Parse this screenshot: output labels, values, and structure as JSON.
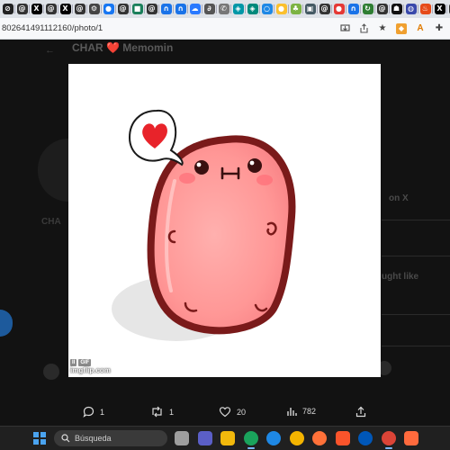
{
  "browser": {
    "tabs": [
      {
        "icon": "x-logo-icon",
        "color": "#222222",
        "glyph": "⊘"
      },
      {
        "icon": "threads-icon",
        "color": "#333333",
        "glyph": "@"
      },
      {
        "icon": "x-logo-icon",
        "color": "#000000",
        "glyph": "X"
      },
      {
        "icon": "threads-icon",
        "color": "#333333",
        "glyph": "@"
      },
      {
        "icon": "x-logo-icon",
        "color": "#000000",
        "glyph": "X"
      },
      {
        "icon": "threads-icon",
        "color": "#333333",
        "glyph": "@"
      },
      {
        "icon": "settings-icon",
        "color": "#444444",
        "glyph": "⚙"
      },
      {
        "icon": "blue-circle-icon",
        "color": "#1877f2",
        "glyph": "●"
      },
      {
        "icon": "threads-icon",
        "color": "#333333",
        "glyph": "@"
      },
      {
        "icon": "green-square-icon",
        "color": "#1a7f5a",
        "glyph": "■"
      },
      {
        "icon": "threads-icon",
        "color": "#333333",
        "glyph": "@"
      },
      {
        "icon": "gmail-icon",
        "color": "#1a73e8",
        "glyph": "∩"
      },
      {
        "icon": "gmail-icon",
        "color": "#1a73e8",
        "glyph": "∩"
      },
      {
        "icon": "cloud-icon",
        "color": "#2979ff",
        "glyph": "☁"
      },
      {
        "icon": "loop-icon",
        "color": "#555555",
        "glyph": "∂"
      },
      {
        "icon": "key-icon",
        "color": "#777777",
        "glyph": "✆"
      },
      {
        "icon": "shield-icon",
        "color": "#0097a7",
        "glyph": "◈"
      },
      {
        "icon": "shield-icon",
        "color": "#00897b",
        "glyph": "◈"
      },
      {
        "icon": "circle-icon",
        "color": "#1e88e5",
        "glyph": "○"
      },
      {
        "icon": "ball-icon",
        "color": "#fbc02d",
        "glyph": "●"
      },
      {
        "icon": "leaf-icon",
        "color": "#7cb342",
        "glyph": "♣"
      },
      {
        "icon": "film-icon",
        "color": "#455a64",
        "glyph": "▣"
      },
      {
        "icon": "threads-icon",
        "color": "#333333",
        "glyph": "@"
      },
      {
        "icon": "record-icon",
        "color": "#e53935",
        "glyph": "●"
      },
      {
        "icon": "gmail-icon",
        "color": "#1a73e8",
        "glyph": "∩"
      },
      {
        "icon": "sync-icon",
        "color": "#2e7d32",
        "glyph": "↻"
      },
      {
        "icon": "threads-icon",
        "color": "#333333",
        "glyph": "@"
      },
      {
        "icon": "mask-icon",
        "color": "#111111",
        "glyph": "☗"
      },
      {
        "icon": "globe-icon",
        "color": "#3949ab",
        "glyph": "◍"
      },
      {
        "icon": "hot-icon",
        "color": "#e64a19",
        "glyph": "♨"
      },
      {
        "icon": "x-logo-icon",
        "color": "#000000",
        "glyph": "X"
      },
      {
        "icon": "threads-icon",
        "color": "#333333",
        "glyph": "@"
      },
      {
        "icon": "spiral-icon",
        "color": "#6a1b9a",
        "glyph": "✲"
      },
      {
        "icon": "threads-icon",
        "color": "#333333",
        "glyph": "@"
      }
    ],
    "url": "802641491112160/photo/1"
  },
  "background": {
    "header_title": "CHAR ❤️ Memomin",
    "left_text_1": "CHA",
    "right_text_1": "on X",
    "right_text_2": "ught like"
  },
  "media": {
    "badge_chips": [
      "II",
      "GIF"
    ],
    "badge_brand": "imgflip.com"
  },
  "actions": {
    "reply_count": "1",
    "repost_count": "1",
    "like_count": "20",
    "views_count": "782"
  },
  "taskbar": {
    "search_placeholder": "Búsqueda",
    "apps": [
      {
        "icon": "task-view-icon",
        "color": "#9e9e9e"
      },
      {
        "icon": "teams-icon",
        "color": "#5b5fc7"
      },
      {
        "icon": "file-explorer-icon",
        "color": "#f2b90c"
      },
      {
        "icon": "edge-icon",
        "color": "#1aa35c"
      },
      {
        "icon": "store-icon",
        "color": "#1e88e5"
      },
      {
        "icon": "chrome-canary-icon",
        "color": "#f4b400"
      },
      {
        "icon": "firefox-icon",
        "color": "#ff7139"
      },
      {
        "icon": "brave-icon",
        "color": "#fb542b"
      },
      {
        "icon": "vpn-icon",
        "color": "#0057b8"
      },
      {
        "icon": "chrome-icon",
        "color": "#db4437"
      },
      {
        "icon": "brave-beta-icon",
        "color": "#ff6a3d"
      }
    ]
  }
}
